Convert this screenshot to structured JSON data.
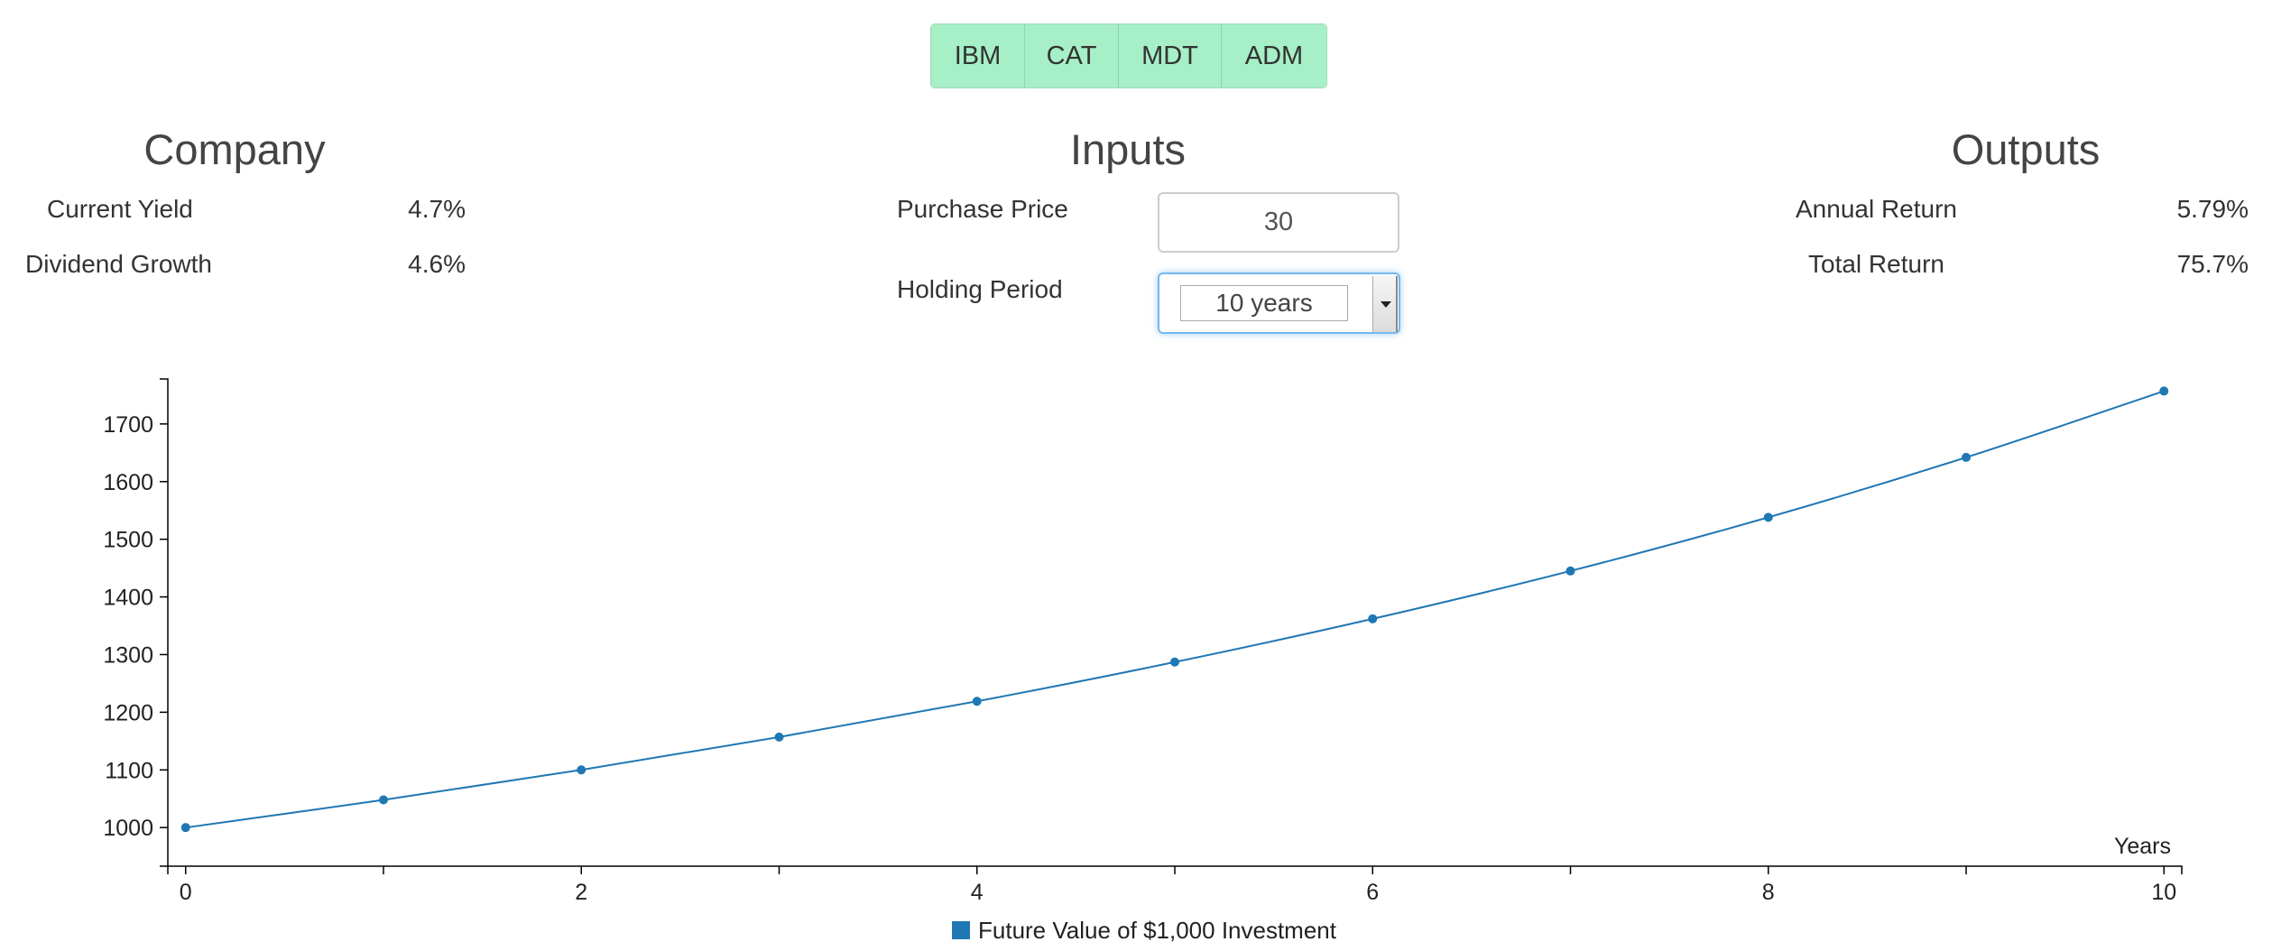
{
  "tickers": [
    "IBM",
    "CAT",
    "MDT",
    "ADM"
  ],
  "company": {
    "heading": "Company",
    "rows": [
      {
        "label": "Current Yield",
        "value": "4.7%"
      },
      {
        "label": "Dividend Growth",
        "value": "4.6%"
      }
    ]
  },
  "inputs": {
    "heading": "Inputs",
    "purchase_price_label": "Purchase Price",
    "purchase_price_value": "30",
    "holding_period_label": "Holding Period",
    "holding_period_value": "10 years"
  },
  "outputs": {
    "heading": "Outputs",
    "rows": [
      {
        "label": "Annual Return",
        "value": "5.79%"
      },
      {
        "label": "Total Return",
        "value": "75.7%"
      }
    ]
  },
  "colors": {
    "tab_bg": "#a6efc7",
    "series": "#1f77b4",
    "focus_border": "#74b9f0"
  },
  "chart_data": {
    "type": "line",
    "x": [
      0,
      1,
      2,
      3,
      4,
      5,
      6,
      7,
      8,
      9,
      10
    ],
    "series": [
      {
        "name": "Future Value of $1,000 Investment",
        "values": [
          1000,
          1048,
          1100,
          1157,
          1219,
          1287,
          1362,
          1445,
          1538,
          1642,
          1757
        ]
      }
    ],
    "xlabel": "Years",
    "ylabel": "",
    "x_ticks": [
      0,
      1,
      2,
      3,
      4,
      5,
      6,
      7,
      8,
      9,
      10
    ],
    "x_tick_labels": [
      "0",
      "",
      "2",
      "",
      "4",
      "",
      "6",
      "",
      "8",
      "",
      "10"
    ],
    "y_ticks": [
      1000,
      1100,
      1200,
      1300,
      1400,
      1500,
      1600,
      1700
    ],
    "xlim": [
      -0.09,
      10.09
    ],
    "ylim": [
      933,
      1778
    ],
    "grid": false,
    "legend_position": "bottom-center"
  }
}
